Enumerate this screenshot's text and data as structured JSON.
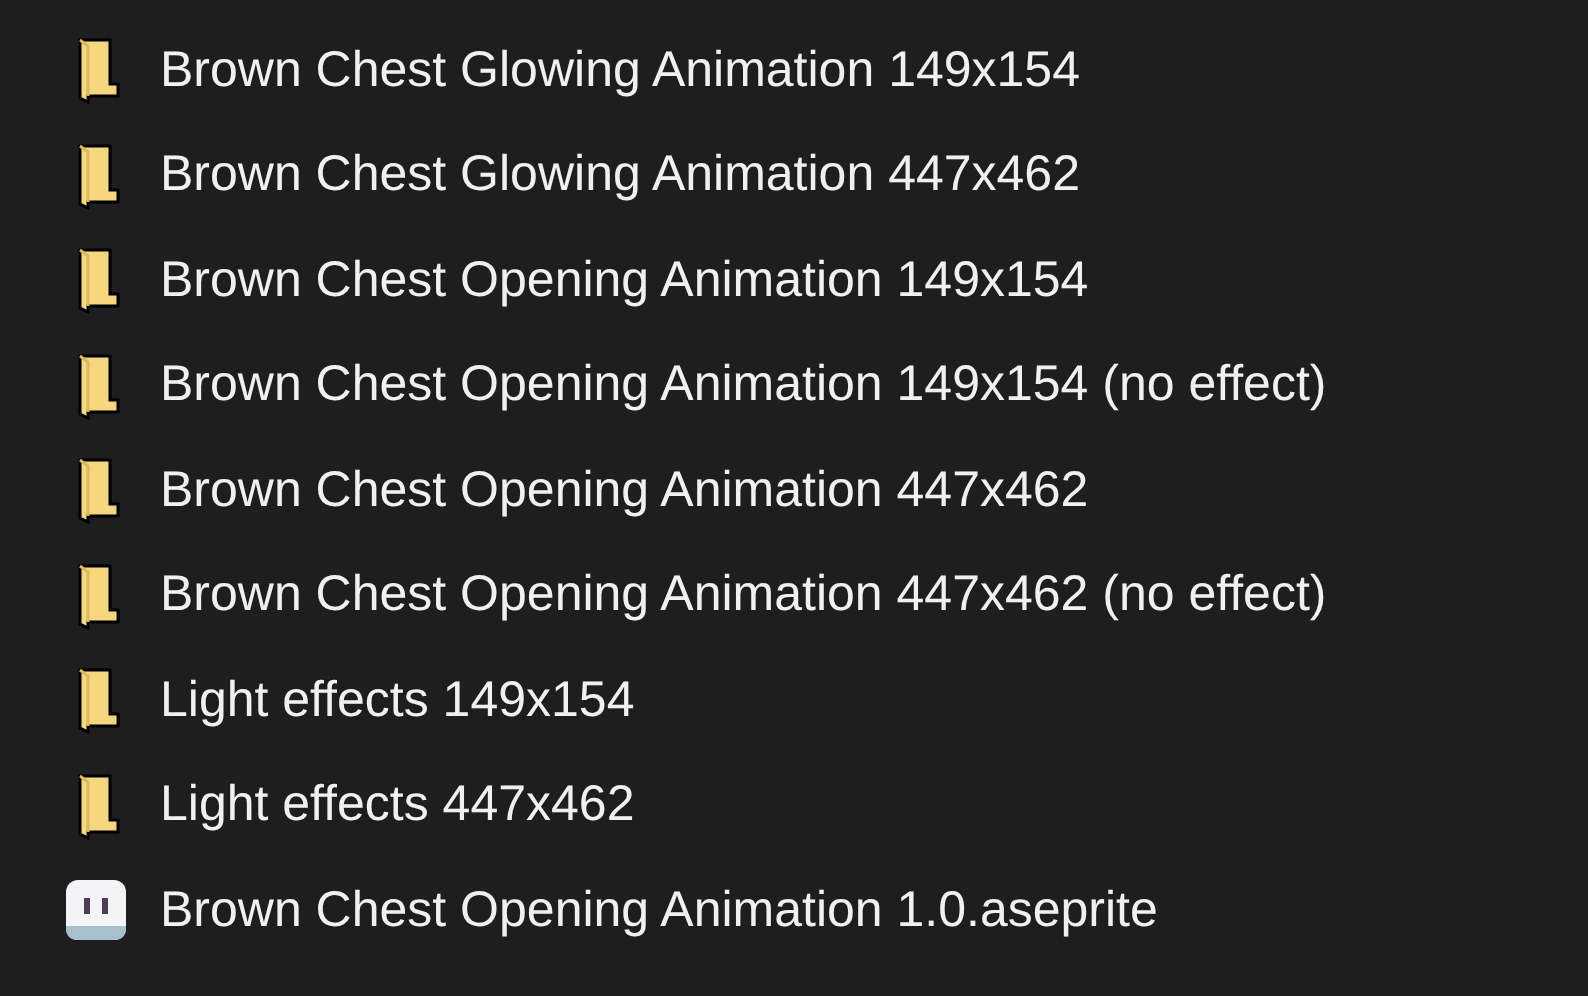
{
  "items": [
    {
      "kind": "folder",
      "name": "Brown Chest Glowing Animation 149x154"
    },
    {
      "kind": "folder",
      "name": "Brown Chest Glowing Animation 447x462"
    },
    {
      "kind": "folder",
      "name": "Brown Chest Opening Animation 149x154"
    },
    {
      "kind": "folder",
      "name": "Brown Chest Opening Animation 149x154 (no effect)"
    },
    {
      "kind": "folder",
      "name": "Brown Chest Opening Animation 447x462"
    },
    {
      "kind": "folder",
      "name": "Brown Chest Opening Animation 447x462 (no effect)"
    },
    {
      "kind": "folder",
      "name": "Light effects 149x154"
    },
    {
      "kind": "folder",
      "name": "Light effects 447x462"
    },
    {
      "kind": "file",
      "name": "Brown Chest Opening Animation 1.0.aseprite"
    }
  ]
}
